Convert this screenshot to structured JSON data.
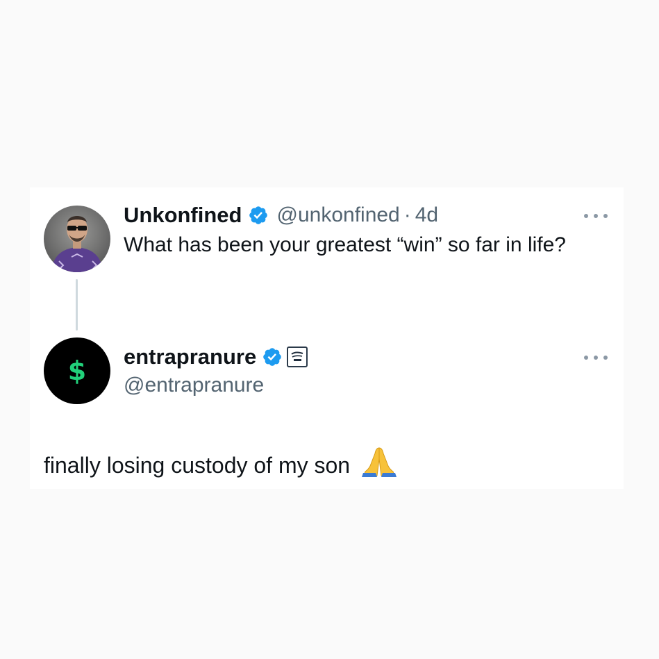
{
  "tweet1": {
    "display_name": "Unkonfined",
    "handle": "@unkonfined",
    "separator": "·",
    "time": "4d",
    "text": "What has been your greatest “win” so far in life?"
  },
  "tweet2": {
    "display_name": "entrapranure",
    "handle": "@entrapranure",
    "avatar_symbol": "$",
    "text": "finally losing custody of my son"
  },
  "icons": {
    "verified": "verified-badge-icon",
    "more": "more-options-icon",
    "affiliate": "affiliate-badge-icon",
    "emoji": "folded-hands-emoji"
  },
  "colors": {
    "verified_blue": "#1d9bf0",
    "text": "#0f1419",
    "muted": "#536471",
    "dollar_green": "#21d07a"
  }
}
